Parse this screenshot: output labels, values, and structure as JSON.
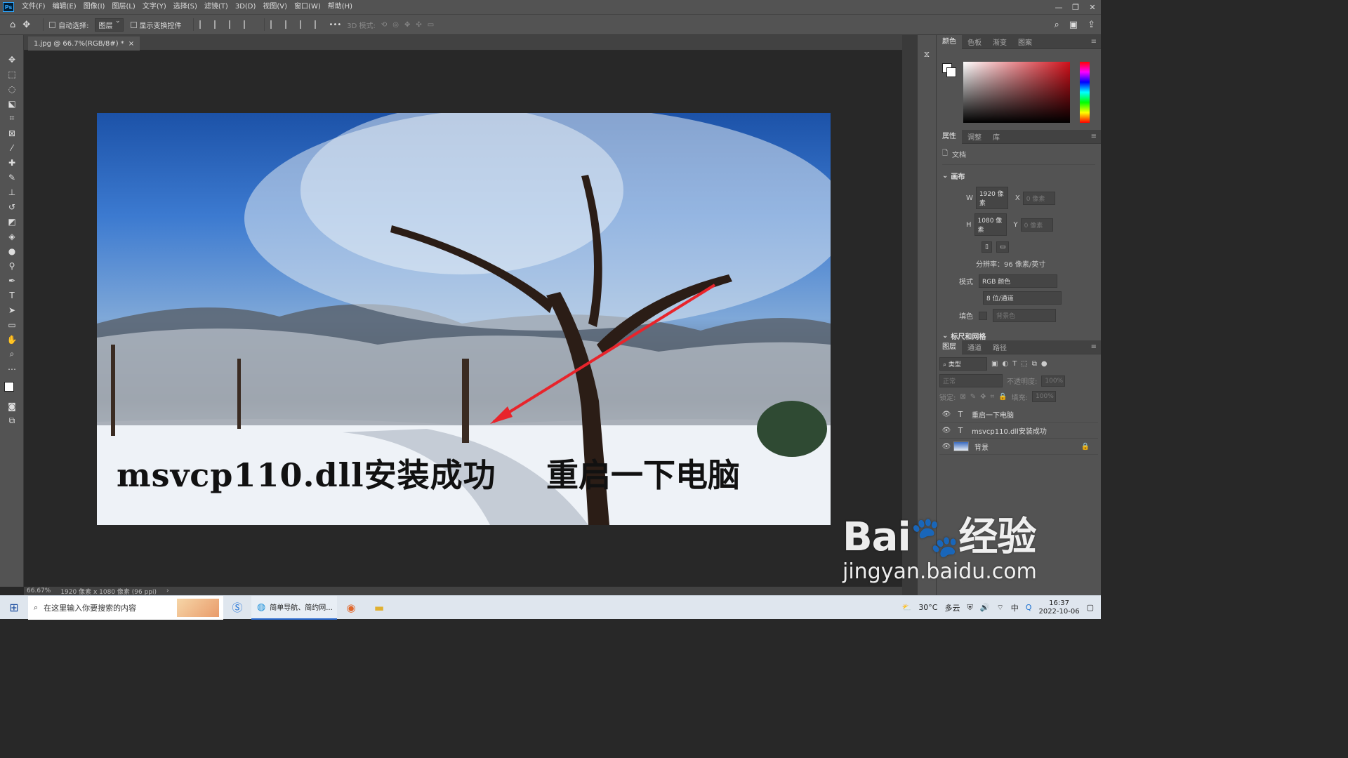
{
  "menu": {
    "logo": "Ps",
    "items": [
      "文件(F)",
      "编辑(E)",
      "图像(I)",
      "图层(L)",
      "文字(Y)",
      "选择(S)",
      "滤镜(T)",
      "3D(D)",
      "视图(V)",
      "窗口(W)",
      "帮助(H)"
    ],
    "window_controls": [
      "—",
      "❐",
      "✕"
    ]
  },
  "options": {
    "auto_select_label": "自动选择:",
    "layer_select_value": "图层",
    "show_transform_label": "显示变换控件",
    "more": "•••",
    "mode_3d_label": "3D 模式:"
  },
  "document": {
    "tab_title": "1.jpg @ 66.7%(RGB/8#) *",
    "tab_close": "×",
    "overlay_text_1": "msvcp110.dll安装成功",
    "overlay_text_2": "重启一下电脑"
  },
  "status": {
    "zoom": "66.67%",
    "doc_info": "1920 像素 x 1080 像素 (96 ppi)",
    "arrow": "›"
  },
  "color_panel": {
    "tabs": [
      "颜色",
      "色板",
      "渐变",
      "图案"
    ],
    "accent_hue": "#d0101a"
  },
  "properties_panel": {
    "tabs": [
      "属性",
      "调整",
      "库"
    ],
    "doc_label": "文档",
    "canvas_section": "画布",
    "w_label": "W",
    "w_value": "1920 像素",
    "x_label": "X",
    "x_value": "0 像素",
    "h_label": "H",
    "h_value": "1080 像素",
    "y_label": "Y",
    "y_value": "0 像素",
    "resolution": "分辨率：96 像素/英寸",
    "mode_label": "模式",
    "mode_value": "RGB 颜色",
    "depth_value": "8 位/通道",
    "fill_label": "填色",
    "fill_value": "背景色",
    "rulers_section": "标尺和网格"
  },
  "layers_panel": {
    "tabs": [
      "图层",
      "通道",
      "路径"
    ],
    "filter_kind": "类型",
    "blend_mode": "正常",
    "opacity_label": "不透明度:",
    "opacity_value": "100%",
    "lock_label": "锁定:",
    "fill_label": "填充:",
    "fill_value": "100%",
    "layers": [
      {
        "type": "T",
        "name": "重启一下电脑"
      },
      {
        "type": "T",
        "name": "msvcp110.dll安装成功"
      },
      {
        "type": "image",
        "name": "背景",
        "locked": true
      }
    ]
  },
  "taskbar": {
    "search_placeholder": "在这里输入你要搜索的内容",
    "edge_label": "简单导航、简约网...",
    "weather_temp": "30°C",
    "weather_text": "多云",
    "time": "16:37",
    "date": "2022-10-06"
  },
  "watermark": {
    "brand": "Bai",
    "brand_suffix": "经验",
    "url": "jingyan.baidu.com"
  }
}
